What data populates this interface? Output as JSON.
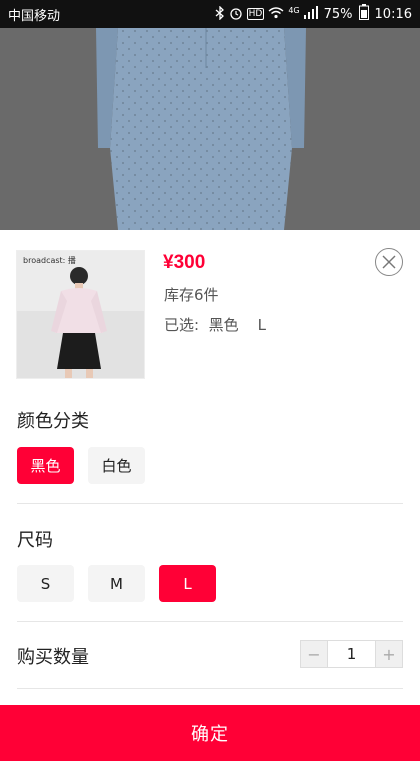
{
  "status_bar": {
    "carrier": "中国移动",
    "network_badge": "HD",
    "network_type": "4G",
    "battery": "75%",
    "time": "10:16",
    "icons": [
      "bluetooth-icon",
      "alarm-icon",
      "hd-icon",
      "wifi-icon",
      "signal-icon",
      "battery-icon"
    ]
  },
  "product": {
    "image_watermark": "broadcast: 播",
    "price": "¥300",
    "stock": "库存6件",
    "selected": "已选:  黑色    L"
  },
  "color_section": {
    "title": "颜色分类",
    "options": [
      "黑色",
      "白色"
    ],
    "selected": "黑色"
  },
  "size_section": {
    "title": "尺码",
    "options": [
      "S",
      "M",
      "L"
    ],
    "selected": "L"
  },
  "quantity_section": {
    "title": "购买数量",
    "minus": "−",
    "value": "1",
    "plus": "+"
  },
  "confirm_label": "确定",
  "colors": {
    "accent": "#ff0036",
    "backdrop": "#6a6a6a",
    "chip_bg": "#f4f4f4"
  }
}
